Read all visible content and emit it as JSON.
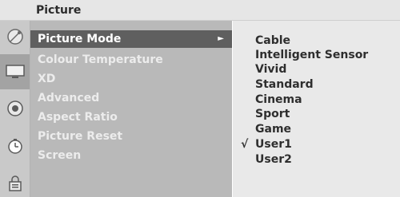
{
  "title": "Picture",
  "icons": [
    {
      "name": "satellite-dish-icon"
    },
    {
      "name": "tv-screen-icon"
    },
    {
      "name": "speaker-icon"
    },
    {
      "name": "clock-icon"
    },
    {
      "name": "lock-icon"
    }
  ],
  "menu": {
    "items": [
      {
        "label": "Picture Mode",
        "selected": true,
        "arrow": "►"
      },
      {
        "label": "Colour Temperature"
      },
      {
        "label": "XD"
      },
      {
        "label": "Advanced"
      },
      {
        "label": "Aspect Ratio"
      },
      {
        "label": "Picture Reset"
      },
      {
        "label": "Screen"
      }
    ]
  },
  "submenu": {
    "options": [
      {
        "label": "Cable"
      },
      {
        "label": "Intelligent Sensor"
      },
      {
        "label": "Vivid"
      },
      {
        "label": "Standard"
      },
      {
        "label": "Cinema"
      },
      {
        "label": "Sport"
      },
      {
        "label": "Game"
      },
      {
        "label": "User1",
        "checked": true
      },
      {
        "label": "User2"
      }
    ],
    "check_mark": "√"
  }
}
